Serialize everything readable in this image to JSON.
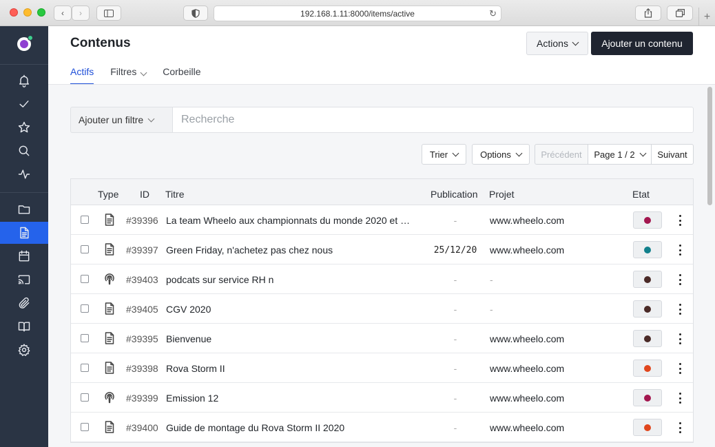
{
  "browser": {
    "url": "192.168.1.11:8000/items/active"
  },
  "sidebar": {
    "items": [
      {
        "icon": "bell-icon"
      },
      {
        "icon": "check-icon"
      },
      {
        "icon": "star-icon"
      },
      {
        "icon": "search-icon"
      },
      {
        "icon": "activity-icon"
      },
      {
        "icon": "folder-icon"
      },
      {
        "icon": "document-icon",
        "active": true
      },
      {
        "icon": "calendar-icon"
      },
      {
        "icon": "cast-icon"
      },
      {
        "icon": "paperclip-icon"
      },
      {
        "icon": "book-icon"
      },
      {
        "icon": "gear-icon"
      }
    ]
  },
  "header": {
    "title": "Contenus",
    "actions_label": "Actions",
    "add_label": "Ajouter un contenu",
    "tabs": [
      {
        "label": "Actifs",
        "active": true
      },
      {
        "label": "Filtres"
      },
      {
        "label": "Corbeille"
      }
    ]
  },
  "search": {
    "filter_label": "Ajouter un filtre",
    "placeholder": "Recherche",
    "value": ""
  },
  "toolbar": {
    "sort_label": "Trier",
    "options_label": "Options",
    "prev_label": "Précédent",
    "page_label": "Page 1 / 2",
    "next_label": "Suivant"
  },
  "table": {
    "columns": {
      "type": "Type",
      "id": "ID",
      "title": "Titre",
      "publication": "Publication",
      "project": "Projet",
      "state": "Etat"
    },
    "rows": [
      {
        "type": "document",
        "id": "#39396",
        "title": "La team Wheelo aux championnats du monde 2020 et …",
        "publication": "-",
        "project": "www.wheelo.com",
        "state_color": "#a3174f"
      },
      {
        "type": "document",
        "id": "#39397",
        "title": "Green Friday, n'achetez pas chez nous",
        "publication": "25/12/20",
        "project": "www.wheelo.com",
        "state_color": "#12808c"
      },
      {
        "type": "podcast",
        "id": "#39403",
        "title": "podcats sur service RH n",
        "publication": "-",
        "project": "-",
        "state_color": "#4a2a27"
      },
      {
        "type": "document",
        "id": "#39405",
        "title": "CGV 2020",
        "publication": "-",
        "project": "-",
        "state_color": "#4a2a27"
      },
      {
        "type": "document",
        "id": "#39395",
        "title": "Bienvenue",
        "publication": "-",
        "project": "www.wheelo.com",
        "state_color": "#4a2a27"
      },
      {
        "type": "document",
        "id": "#39398",
        "title": "Rova Storm II",
        "publication": "-",
        "project": "www.wheelo.com",
        "state_color": "#e0461d"
      },
      {
        "type": "podcast",
        "id": "#39399",
        "title": "Emission 12",
        "publication": "-",
        "project": "www.wheelo.com",
        "state_color": "#a3174f"
      },
      {
        "type": "document",
        "id": "#39400",
        "title": "Guide de montage du Rova Storm II 2020",
        "publication": "-",
        "project": "www.wheelo.com",
        "state_color": "#e0461d"
      }
    ]
  }
}
